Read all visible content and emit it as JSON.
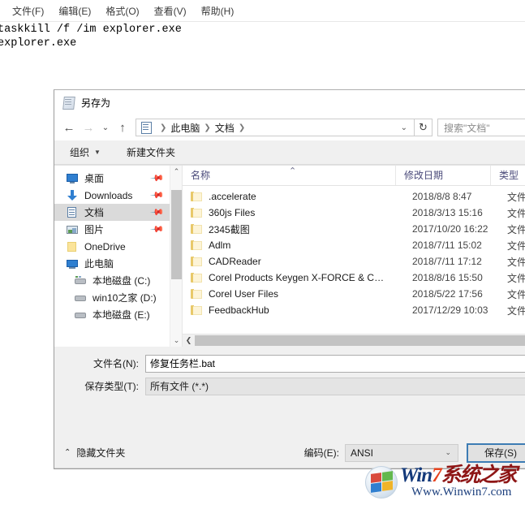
{
  "notepad": {
    "menu": [
      {
        "label": "文件(F)",
        "name": "menu-file"
      },
      {
        "label": "编辑(E)",
        "name": "menu-edit"
      },
      {
        "label": "格式(O)",
        "name": "menu-format"
      },
      {
        "label": "查看(V)",
        "name": "menu-view"
      },
      {
        "label": "帮助(H)",
        "name": "menu-help"
      }
    ],
    "text": "taskkill /f /im explorer.exe\nexplorer.exe"
  },
  "dialog": {
    "title": "另存为",
    "nav": {
      "back": "←",
      "forward": "→",
      "recent": "⌄",
      "up": "↑",
      "crumbs": [
        "此电脑",
        "文档"
      ],
      "crumb_caret": "⌄",
      "refresh": "↻",
      "search_placeholder": "搜索\"文档\""
    },
    "toolbar": {
      "organize": "组织",
      "organize_caret": "▼",
      "new_folder": "新建文件夹"
    },
    "sidebar": [
      {
        "label": "桌面",
        "icon": "desktop-icon",
        "pinned": true,
        "indent": false,
        "selected": false
      },
      {
        "label": "Downloads",
        "icon": "download-icon",
        "pinned": true,
        "indent": false,
        "selected": false
      },
      {
        "label": "文档",
        "icon": "documents-icon",
        "pinned": true,
        "indent": false,
        "selected": true
      },
      {
        "label": "图片",
        "icon": "pictures-icon",
        "pinned": true,
        "indent": false,
        "selected": false
      },
      {
        "label": "OneDrive",
        "icon": "onedrive-icon",
        "pinned": false,
        "indent": false,
        "selected": false
      },
      {
        "label": "此电脑",
        "icon": "computer-icon",
        "pinned": false,
        "indent": false,
        "selected": false
      },
      {
        "label": "本地磁盘 (C:)",
        "icon": "drive-icon",
        "pinned": false,
        "indent": true,
        "selected": false
      },
      {
        "label": "win10之家 (D:)",
        "icon": "drive-icon",
        "pinned": false,
        "indent": true,
        "selected": false
      },
      {
        "label": "本地磁盘 (E:)",
        "icon": "drive-icon",
        "pinned": false,
        "indent": true,
        "selected": false
      }
    ],
    "columns": {
      "name": "名称",
      "date": "修改日期",
      "type": "类型",
      "sort_arrow": "⌃"
    },
    "files": [
      {
        "name": ".accelerate",
        "date": "2018/8/8 8:47",
        "type": "文件夹"
      },
      {
        "name": "360js Files",
        "date": "2018/3/13 15:16",
        "type": "文件夹"
      },
      {
        "name": "2345截图",
        "date": "2017/10/20 16:22",
        "type": "文件夹"
      },
      {
        "name": "Adlm",
        "date": "2018/7/11 15:02",
        "type": "文件夹"
      },
      {
        "name": "CADReader",
        "date": "2018/7/11 17:12",
        "type": "文件夹"
      },
      {
        "name": "Corel Products Keygen X-FORCE & C…",
        "date": "2018/8/16 15:50",
        "type": "文件夹"
      },
      {
        "name": "Corel User Files",
        "date": "2018/5/22 17:56",
        "type": "文件夹"
      },
      {
        "name": "FeedbackHub",
        "date": "2017/12/29 10:03",
        "type": "文件夹"
      }
    ],
    "fields": {
      "filename_label": "文件名(N):",
      "filename_value": "修复任务栏.bat",
      "savetype_label": "保存类型(T):",
      "savetype_value": "所有文件  (*.*)"
    },
    "footer": {
      "hide_folders": "隐藏文件夹",
      "hide_chevron": "⌃",
      "encoding_label": "编码(E):",
      "encoding_value": "ANSI",
      "encoding_caret": "⌄",
      "save_button": "保存(S)"
    },
    "scroll": {
      "up_arrow": "⌃",
      "down_arrow": "⌄",
      "left_arrow": "❮"
    }
  },
  "watermark": {
    "win": "Win",
    "seven": "7",
    "cn": "系统之家",
    "url": "Www.Winwin7.com"
  }
}
